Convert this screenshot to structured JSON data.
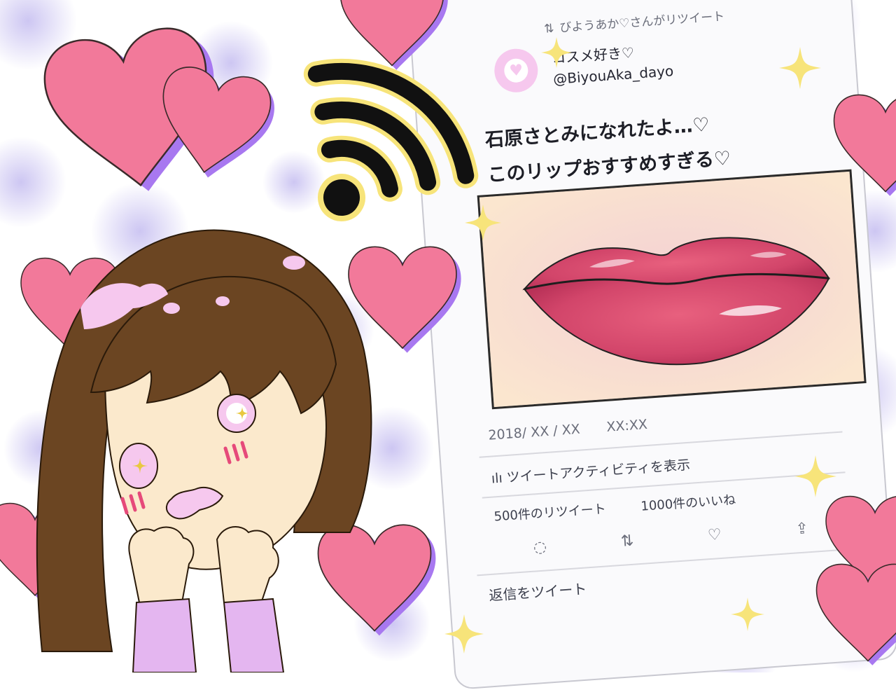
{
  "tweet": {
    "retweeted_by": "びようあか♡さんがリツイート",
    "display_name": "コスメ好き♡",
    "handle": "@BiyouAka_dayo",
    "message_line1": "石原さとみになれたよ…♡",
    "message_line2": "このリップおすすめすぎる♡",
    "date": "2018/ XX / XX　　XX:XX",
    "activity_link": "ツイートアクティビティを表示",
    "retweet_count_text": "500件のリツイート",
    "like_count_text": "1000件のいいね",
    "reply_placeholder": "返信をツイート"
  },
  "icons": {
    "retweet": "retweet-icon",
    "reply": "reply-icon",
    "like": "heart-icon",
    "share": "share-icon",
    "activity": "bar-chart-icon",
    "wifi": "wifi-icon"
  },
  "colors": {
    "heart_pink": "#f2799a",
    "heart_shadow": "#a878f0",
    "polka_dot": "#cdc6f2",
    "sparkle": "#f7e47a",
    "hair": "#6b4522",
    "skin": "#fbe9cc",
    "lips": "#d64a6c"
  }
}
